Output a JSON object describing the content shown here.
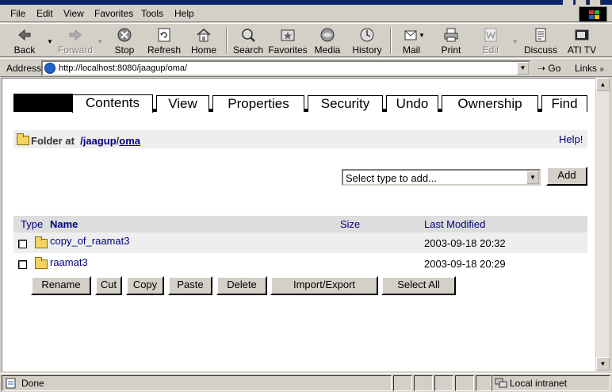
{
  "menu": [
    "File",
    "Edit",
    "View",
    "Favorites",
    "Tools",
    "Help"
  ],
  "toolbar": {
    "back": "Back",
    "forward": "Forward",
    "stop": "Stop",
    "refresh": "Refresh",
    "home": "Home",
    "search": "Search",
    "favorites": "Favorites",
    "media": "Media",
    "history": "History",
    "mail": "Mail",
    "print": "Print",
    "edit": "Edit",
    "discuss": "Discuss",
    "ati": "ATI TV"
  },
  "address": {
    "label": "Address",
    "url": "http://localhost:8080/jaagup/oma/",
    "go": "Go",
    "links": "Links"
  },
  "tabs": [
    "Contents",
    "View",
    "Properties",
    "Security",
    "Undo",
    "Ownership",
    "Find"
  ],
  "breadcrumb": {
    "prefix": "Folder at",
    "path1": "/jaagup",
    "sep": "/",
    "path2": "oma",
    "help": "Help!"
  },
  "add": {
    "select_value": "Select type to add...",
    "button": "Add"
  },
  "table": {
    "headers": {
      "type": "Type",
      "name": "Name",
      "size": "Size",
      "modified": "Last Modified"
    },
    "rows": [
      {
        "name": "copy_of_raamat3",
        "size": "",
        "modified": "2003-09-18 20:32"
      },
      {
        "name": "raamat3",
        "size": "",
        "modified": "2003-09-18 20:29"
      }
    ]
  },
  "actions": [
    "Rename",
    "Cut",
    "Copy",
    "Paste",
    "Delete",
    "Import/Export",
    "Select All"
  ],
  "status": {
    "text": "Done",
    "zone": "Local intranet"
  },
  "colors": {
    "link": "#000080",
    "folder": "#f4d35e",
    "chrome": "#d4d0c8"
  }
}
